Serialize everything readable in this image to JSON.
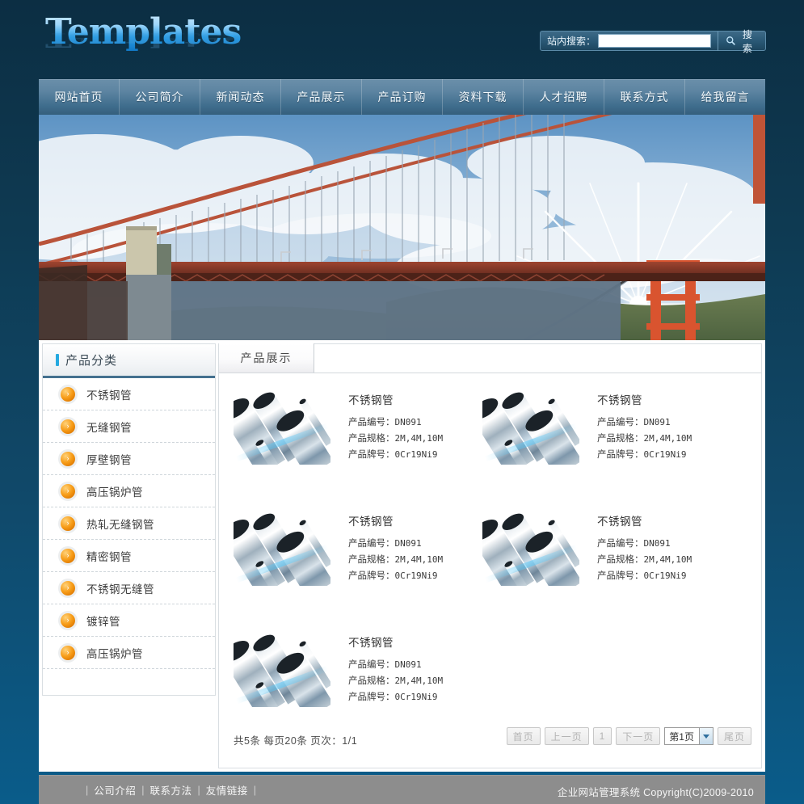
{
  "header": {
    "logo_text": "Templates",
    "search": {
      "label": "站内搜索：",
      "input_value": "",
      "placeholder": "",
      "button_label": "搜 索",
      "icon": "search-icon"
    }
  },
  "nav": {
    "items": [
      {
        "label": "网站首页"
      },
      {
        "label": "公司简介"
      },
      {
        "label": "新闻动态"
      },
      {
        "label": "产品展示"
      },
      {
        "label": "产品订购"
      },
      {
        "label": "资料下载"
      },
      {
        "label": "人才招聘"
      },
      {
        "label": "联系方式"
      },
      {
        "label": "给我留言"
      }
    ]
  },
  "banner": {
    "alt": "golden-gate-bridge-banner"
  },
  "sidebar": {
    "title": "产品分类",
    "items": [
      {
        "label": "不锈钢管",
        "icon": "arrow-circle-icon"
      },
      {
        "label": "无缝钢管",
        "icon": "arrow-circle-icon"
      },
      {
        "label": "厚壁钢管",
        "icon": "arrow-circle-icon"
      },
      {
        "label": "高压锅炉管",
        "icon": "arrow-circle-icon"
      },
      {
        "label": "热轧无缝钢管",
        "icon": "arrow-circle-icon"
      },
      {
        "label": "精密钢管",
        "icon": "arrow-circle-icon"
      },
      {
        "label": "不锈钢无缝管",
        "icon": "arrow-circle-icon"
      },
      {
        "label": "镀锌管",
        "icon": "arrow-circle-icon"
      },
      {
        "label": "高压锅炉管",
        "icon": "arrow-circle-icon"
      }
    ]
  },
  "content": {
    "tab_label": "产品展示",
    "field_labels": {
      "code": "产品编号：",
      "spec": "产品规格：",
      "grade": "产品牌号："
    },
    "products": [
      {
        "title": "不锈钢管",
        "code": "DN091",
        "spec": "2M,4M,10M",
        "grade": "0Cr19Ni9"
      },
      {
        "title": "不锈钢管",
        "code": "DN091",
        "spec": "2M,4M,10M",
        "grade": "0Cr19Ni9"
      },
      {
        "title": "不锈钢管",
        "code": "DN091",
        "spec": "2M,4M,10M",
        "grade": "0Cr19Ni9"
      },
      {
        "title": "不锈钢管",
        "code": "DN091",
        "spec": "2M,4M,10M",
        "grade": "0Cr19Ni9"
      },
      {
        "title": "不锈钢管",
        "code": "DN091",
        "spec": "2M,4M,10M",
        "grade": "0Cr19Ni9"
      }
    ],
    "pager": {
      "info": "共5条 每页20条 页次：1/1",
      "first": "首页",
      "prev": "上一页",
      "current_num": "1",
      "next": "下一页",
      "select_value": "第1页",
      "select_options": [
        "第1页"
      ],
      "last": "尾页"
    }
  },
  "footer": {
    "links": [
      "公司介绍",
      "联系方法",
      "友情链接"
    ],
    "separator": "|",
    "copyright": "企业网站管理系统  Copyright(C)2009-2010"
  },
  "colors": {
    "page_bg_top": "#0c2e43",
    "page_bg_bottom": "#0a5c8a",
    "nav_top": "#6b8faa",
    "nav_bottom": "#355f7d",
    "accent_cyan": "#25a9e0",
    "accent_orange": "#f79c17",
    "sidebar_rule": "#44718f",
    "footer_bg": "#8d8d8d"
  }
}
